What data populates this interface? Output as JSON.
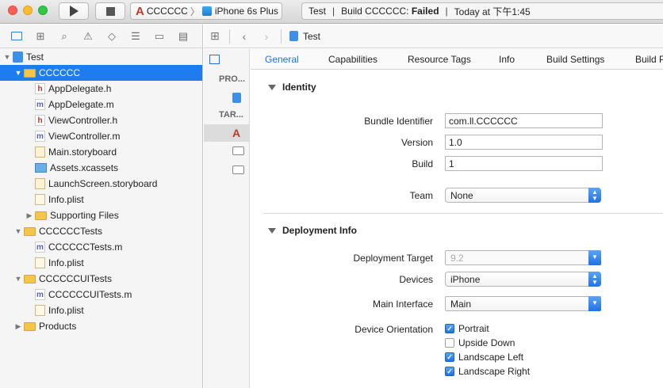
{
  "toolbar": {
    "scheme_name": "CCCCCC",
    "device_name": "iPhone 6s Plus",
    "status_project": "Test",
    "status_build_label": "Build CCCCCC:",
    "status_build_result": "Failed",
    "status_time": "Today at 下午1:45"
  },
  "navigator": {
    "tabs": [
      "folder-icon",
      "hierarchy-icon",
      "search-icon",
      "warning-icon",
      "test-icon",
      "debug-icon",
      "breakpoint-icon",
      "report-icon"
    ],
    "items": [
      {
        "label": "Test",
        "type": "project",
        "disclosure": "open",
        "depth": 0
      },
      {
        "label": "CCCCCC",
        "type": "folder",
        "disclosure": "open",
        "depth": 1,
        "selected": true
      },
      {
        "label": "AppDelegate.h",
        "type": "h",
        "depth": 2
      },
      {
        "label": "AppDelegate.m",
        "type": "m",
        "depth": 2
      },
      {
        "label": "ViewController.h",
        "type": "h",
        "depth": 2
      },
      {
        "label": "ViewController.m",
        "type": "m",
        "depth": 2
      },
      {
        "label": "Main.storyboard",
        "type": "storyboard",
        "depth": 2
      },
      {
        "label": "Assets.xcassets",
        "type": "assets",
        "depth": 2
      },
      {
        "label": "LaunchScreen.storyboard",
        "type": "storyboard",
        "depth": 2
      },
      {
        "label": "Info.plist",
        "type": "plist",
        "depth": 2
      },
      {
        "label": "Supporting Files",
        "type": "folder",
        "disclosure": "closed",
        "depth": 2
      },
      {
        "label": "CCCCCCTests",
        "type": "folder",
        "disclosure": "open",
        "depth": 1
      },
      {
        "label": "CCCCCCTests.m",
        "type": "m",
        "depth": 2
      },
      {
        "label": "Info.plist",
        "type": "plist",
        "depth": 2
      },
      {
        "label": "CCCCCCUITests",
        "type": "folder",
        "disclosure": "open",
        "depth": 1
      },
      {
        "label": "CCCCCCUITests.m",
        "type": "m",
        "depth": 2
      },
      {
        "label": "Info.plist",
        "type": "plist",
        "depth": 2
      },
      {
        "label": "Products",
        "type": "folder",
        "disclosure": "closed",
        "depth": 1
      }
    ]
  },
  "jumpbar": {
    "breadcrumb": "Test"
  },
  "targets": {
    "project_header": "PRO...",
    "targets_header": "TAR..."
  },
  "tabs": [
    "General",
    "Capabilities",
    "Resource Tags",
    "Info",
    "Build Settings",
    "Build P"
  ],
  "identity": {
    "section_title": "Identity",
    "bundle_identifier_label": "Bundle Identifier",
    "bundle_identifier_value": "com.ll.CCCCCC",
    "version_label": "Version",
    "version_value": "1.0",
    "build_label": "Build",
    "build_value": "1",
    "team_label": "Team",
    "team_value": "None"
  },
  "deployment": {
    "section_title": "Deployment Info",
    "target_label": "Deployment Target",
    "target_value": "9.2",
    "devices_label": "Devices",
    "devices_value": "iPhone",
    "main_interface_label": "Main Interface",
    "main_interface_value": "Main",
    "orientation_label": "Device Orientation",
    "orientations": [
      {
        "label": "Portrait",
        "checked": true
      },
      {
        "label": "Upside Down",
        "checked": false
      },
      {
        "label": "Landscape Left",
        "checked": true
      },
      {
        "label": "Landscape Right",
        "checked": true
      }
    ]
  },
  "colors": {
    "selection": "#1c7cf0",
    "accent": "#1a73e8",
    "failed": "#222222"
  }
}
